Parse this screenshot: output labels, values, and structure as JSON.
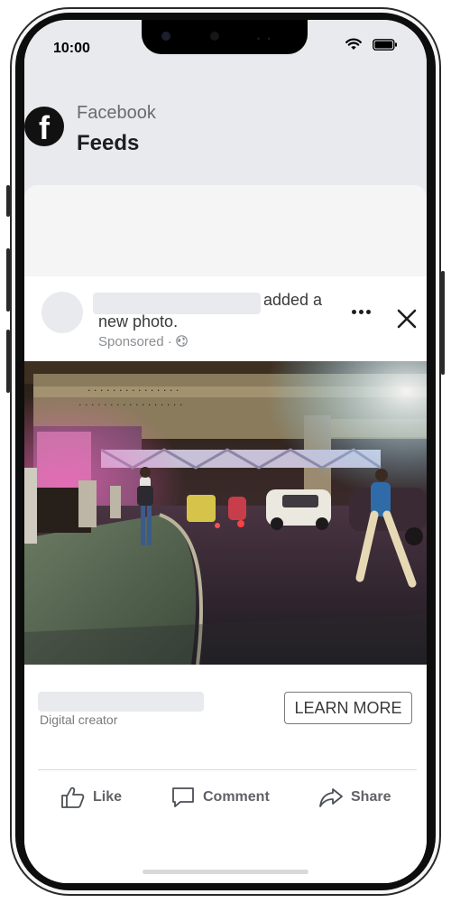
{
  "status": {
    "time": "10:00"
  },
  "header": {
    "app_name": "Facebook",
    "title": "Feeds",
    "logo_letter": "f"
  },
  "post": {
    "action_line1": "added a",
    "action_line2": "new photo.",
    "sponsored": "Sponsored · ",
    "creator_label": "Digital creator",
    "cta_label": "LEARN MORE"
  },
  "actions": {
    "like": "Like",
    "comment": "Comment",
    "share": "Share"
  },
  "colors": {
    "brand_bg": "#e9eaee",
    "text": "#1c1e21",
    "secondary": "#8a8d91"
  },
  "icons": [
    "wifi-icon",
    "battery-icon",
    "facebook-logo",
    "more-icon",
    "close-icon",
    "globe-icon",
    "like-icon",
    "comment-icon",
    "share-icon"
  ]
}
